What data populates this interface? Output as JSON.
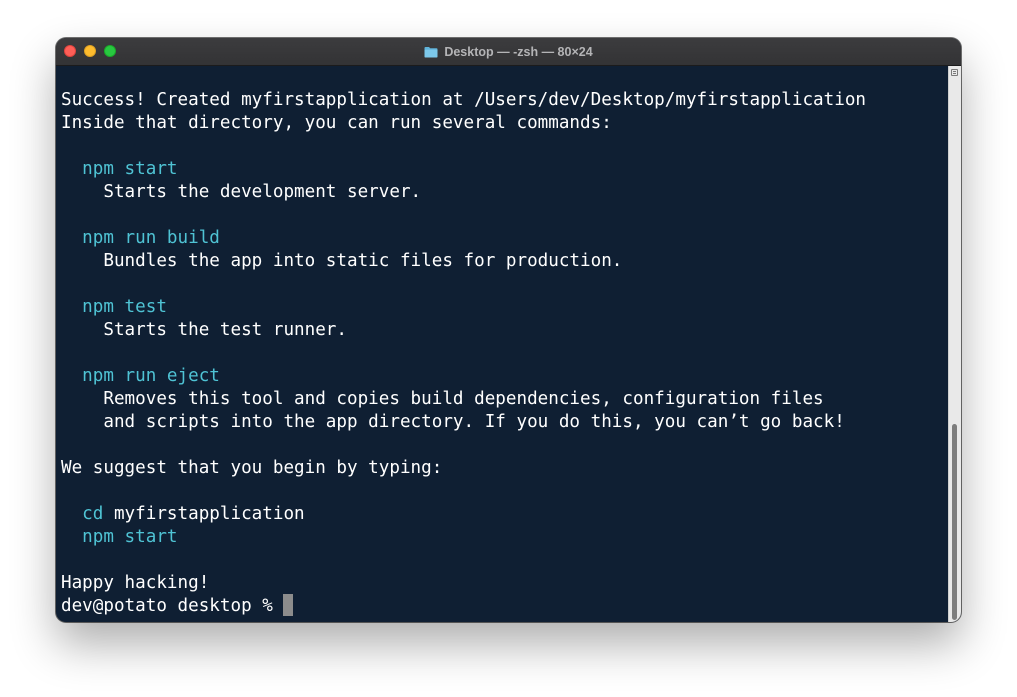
{
  "window": {
    "title": "Desktop — -zsh — 80×24"
  },
  "terminal": {
    "lines": [
      {
        "segments": [
          {
            "text": "",
            "color": "white"
          }
        ]
      },
      {
        "segments": [
          {
            "text": "Success! Created myfirstapplication at /Users/dev/Desktop/myfirstapplication",
            "color": "white"
          }
        ]
      },
      {
        "segments": [
          {
            "text": "Inside that directory, you can run several commands:",
            "color": "white"
          }
        ]
      },
      {
        "segments": [
          {
            "text": "",
            "color": "white"
          }
        ]
      },
      {
        "segments": [
          {
            "text": "  npm start",
            "color": "cyan"
          }
        ]
      },
      {
        "segments": [
          {
            "text": "    Starts the development server.",
            "color": "white"
          }
        ]
      },
      {
        "segments": [
          {
            "text": "",
            "color": "white"
          }
        ]
      },
      {
        "segments": [
          {
            "text": "  npm run build",
            "color": "cyan"
          }
        ]
      },
      {
        "segments": [
          {
            "text": "    Bundles the app into static files for production.",
            "color": "white"
          }
        ]
      },
      {
        "segments": [
          {
            "text": "",
            "color": "white"
          }
        ]
      },
      {
        "segments": [
          {
            "text": "  npm test",
            "color": "cyan"
          }
        ]
      },
      {
        "segments": [
          {
            "text": "    Starts the test runner.",
            "color": "white"
          }
        ]
      },
      {
        "segments": [
          {
            "text": "",
            "color": "white"
          }
        ]
      },
      {
        "segments": [
          {
            "text": "  npm run eject",
            "color": "cyan"
          }
        ]
      },
      {
        "segments": [
          {
            "text": "    Removes this tool and copies build dependencies, configuration files",
            "color": "white"
          }
        ]
      },
      {
        "segments": [
          {
            "text": "    and scripts into the app directory. If you do this, you can’t go back!",
            "color": "white"
          }
        ]
      },
      {
        "segments": [
          {
            "text": "",
            "color": "white"
          }
        ]
      },
      {
        "segments": [
          {
            "text": "We suggest that you begin by typing:",
            "color": "white"
          }
        ]
      },
      {
        "segments": [
          {
            "text": "",
            "color": "white"
          }
        ]
      },
      {
        "segments": [
          {
            "text": "  cd",
            "color": "cyan"
          },
          {
            "text": " myfirstapplication",
            "color": "white"
          }
        ]
      },
      {
        "segments": [
          {
            "text": "  npm start",
            "color": "cyan"
          }
        ]
      },
      {
        "segments": [
          {
            "text": "",
            "color": "white"
          }
        ]
      },
      {
        "segments": [
          {
            "text": "Happy hacking!",
            "color": "white"
          }
        ]
      }
    ],
    "prompt": "dev@potato desktop % ",
    "colors": {
      "background": "#0f1f33",
      "text": "#ffffff",
      "command": "#4fc3d4",
      "cursor": "#8c8c8c"
    }
  },
  "icons": {
    "title": "folder-icon",
    "scroll": "scroll-to-top-icon"
  }
}
